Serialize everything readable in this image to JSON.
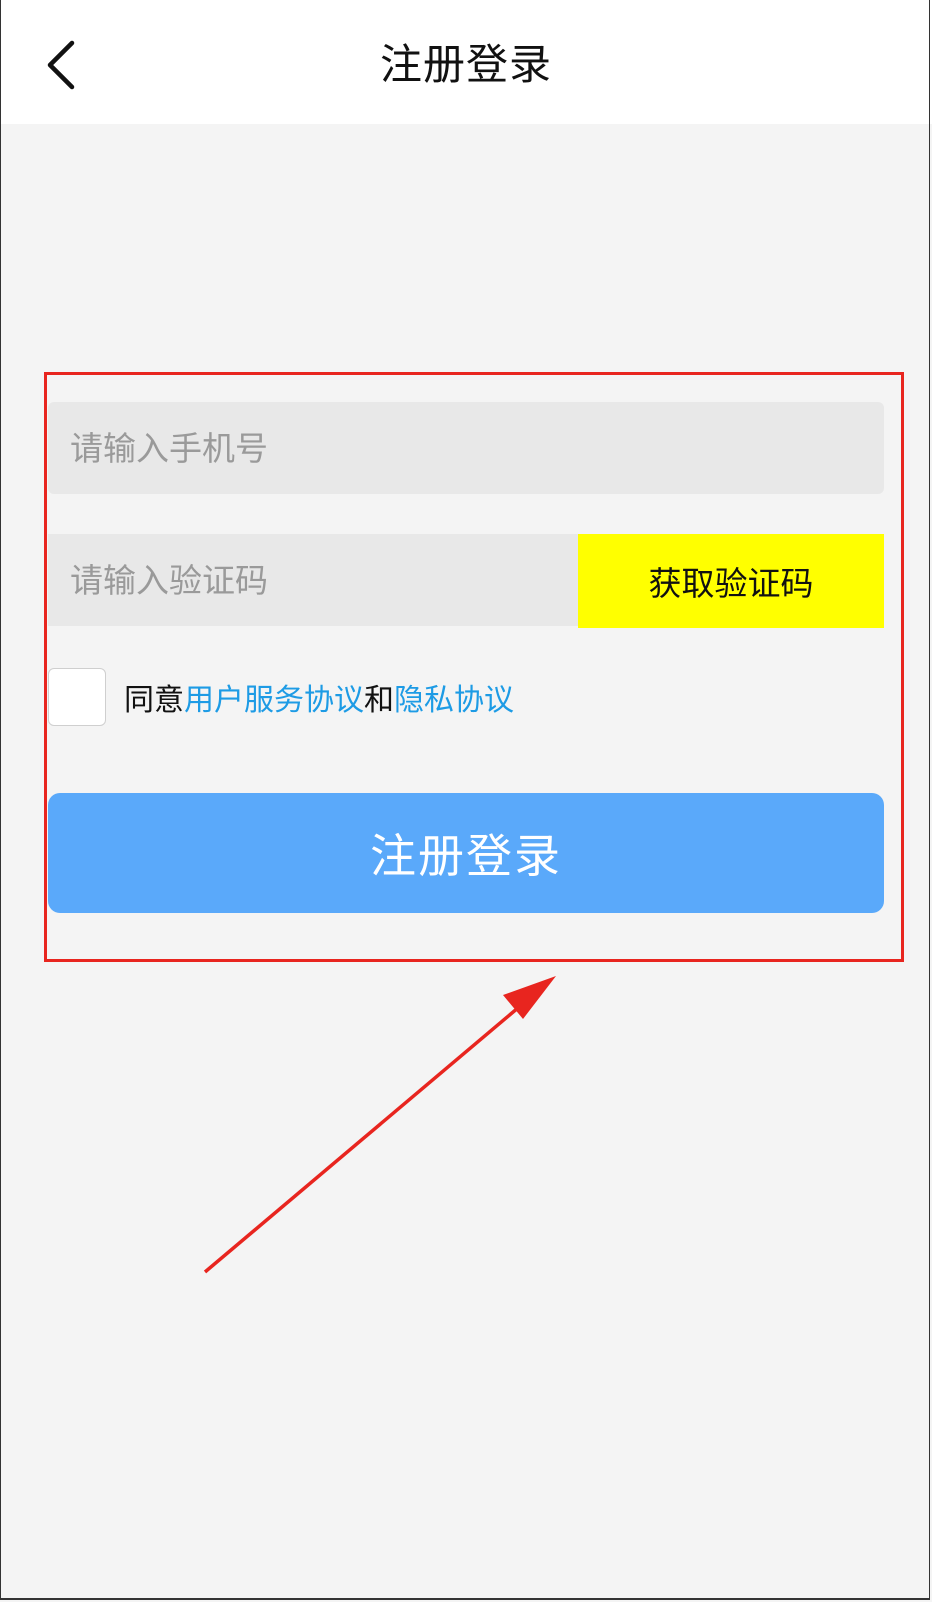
{
  "header": {
    "title": "注册登录",
    "back_icon": "chevron-left-icon"
  },
  "form": {
    "phone_placeholder": "请输入手机号",
    "code_placeholder": "请输入验证码",
    "get_code_label": "获取验证码",
    "agreement": {
      "prefix": "同意",
      "user_agreement": "用户服务协议",
      "conjunction": "和",
      "privacy_policy": "隐私协议",
      "checked": false
    },
    "submit_label": "注册登录"
  },
  "colors": {
    "link": "#1d9be5",
    "submit_bg": "#5aa9fa",
    "get_code_bg": "#ffff00",
    "annotation": "#e8251f",
    "page_bg": "#f4f4f4"
  }
}
